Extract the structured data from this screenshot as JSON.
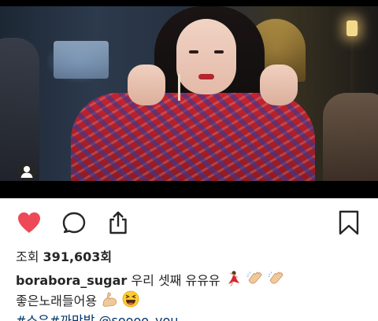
{
  "video": {
    "avatar_icon": "person-icon"
  },
  "actions": {
    "like_icon": "heart-icon",
    "comment_icon": "speech-bubble-icon",
    "share_icon": "share-upload-icon",
    "bookmark_icon": "bookmark-icon",
    "like_color": "#ed4956"
  },
  "views": {
    "label": "조회",
    "count": "391,603회"
  },
  "caption": {
    "username": "borabora_sugar",
    "text_line1": "우리 셋째 유유유",
    "text_line2": "좋은노래들어용",
    "hashtag1": "#소유",
    "hashtag2": "#까만밤",
    "mention": "@soooo_you",
    "emojis_line1": [
      "dancer-emoji",
      "clapping-hands-emoji",
      "clapping-hands-emoji"
    ],
    "emojis_line2": [
      "flexed-biceps-emoji",
      "laughing-face-emoji"
    ]
  },
  "colors": {
    "text": "#262626",
    "link": "#003569",
    "like": "#ed4956"
  }
}
